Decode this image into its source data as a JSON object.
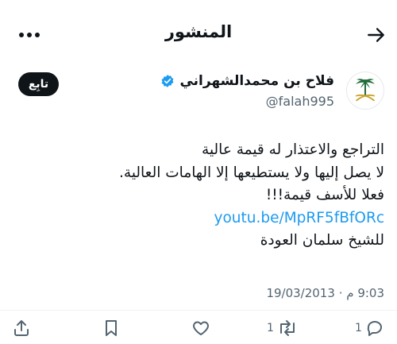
{
  "header": {
    "title": "المنشور",
    "back_icon": "arrow-right-icon",
    "more_icon": "more-options-icon"
  },
  "author": {
    "display_name": "فلاح بن محمدالشهراني",
    "handle": "@falah995",
    "verified_icon": "verified-badge-icon",
    "avatar_icon": "palm-swords-emblem-icon",
    "follow_label": "تابِع"
  },
  "post": {
    "lines": [
      "التراجع والاعتذار له قيمة عالية",
      "لا يصل إليها ولا يستطيعها إلا الهامات العالية.",
      "فعلا للأسف قيمة!!!"
    ],
    "link": "youtu.be/MpRF5fBfORc",
    "last_line": "للشيخ سلمان العودة"
  },
  "meta": {
    "time": "9:03 م",
    "separator": "·",
    "date": "19/03/2013"
  },
  "actions": {
    "replies": "1",
    "reposts": "1",
    "reply_icon": "reply-icon",
    "repost_icon": "repost-icon",
    "like_icon": "heart-icon",
    "bookmark_icon": "bookmark-icon",
    "share_icon": "share-icon"
  },
  "colors": {
    "text": "#0f1419",
    "secondary": "#536471",
    "link": "#1d9bf0",
    "verified": "#1d9bf0",
    "emblem": "#1f6b3a"
  }
}
